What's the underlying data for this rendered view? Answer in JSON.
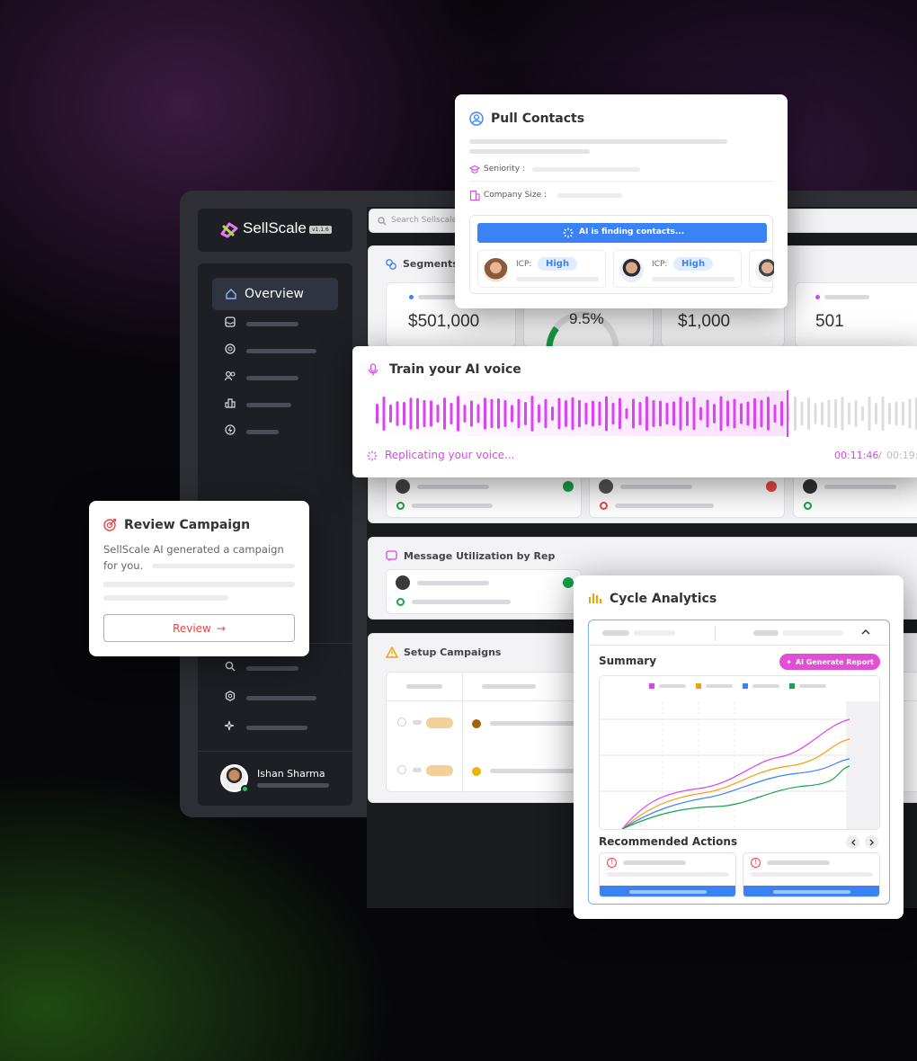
{
  "app": {
    "name": "SellScale",
    "version": "v1.1.6",
    "search_placeholder": "Search Sellscale"
  },
  "sidebar": {
    "active_item": "Overview",
    "user_name": "Ishan Sharma"
  },
  "segments": {
    "title": "Segments",
    "stats": [
      "$501,000",
      "9.5%",
      "$1,000",
      "501"
    ]
  },
  "message_utilization": {
    "title": "Message Utilization by Rep"
  },
  "setup_campaigns": {
    "title": "Setup Campaigns"
  },
  "pull_contacts": {
    "title": "Pull Contacts",
    "seniority_label": "Seniority :",
    "company_size_label": "Company Size :",
    "finding_label": "AI is finding contacts...",
    "icp_label": "ICP:",
    "icp_value": "High"
  },
  "train_voice": {
    "title": "Train your AI voice",
    "status": "Replicating your voice...",
    "elapsed": "00:11:46",
    "separator": "/",
    "total": "00:19:"
  },
  "review_campaign": {
    "title": "Review Campaign",
    "body_line1": "SellScale AI generated a campaign",
    "body_line2": "for you.",
    "button": "Review",
    "button_arrow": "→"
  },
  "cycle_analytics": {
    "title": "Cycle Analytics",
    "summary": "Summary",
    "ai_button": "AI Generate Report",
    "recommended": "Recommended Actions",
    "legend_colors": [
      "#d946ef",
      "#f59e0b",
      "#3b82f6",
      "#16a34a"
    ]
  },
  "colors": {
    "accent_blue": "#3b82f6",
    "accent_pink": "#d946ef",
    "accent_red": "#ef4444",
    "voice_wave": "#d946ef"
  }
}
